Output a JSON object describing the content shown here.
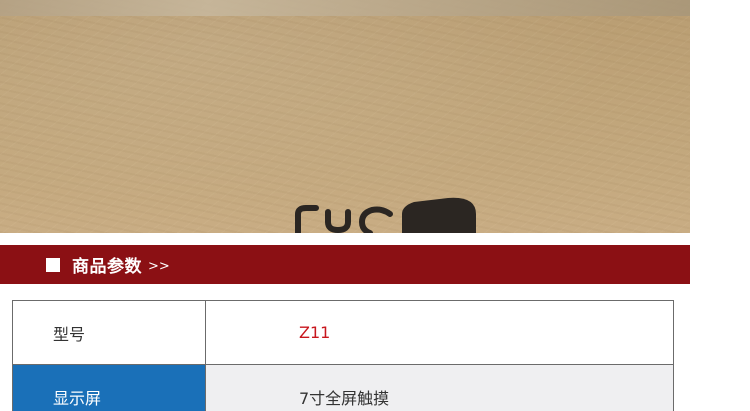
{
  "section": {
    "title": "商品参数",
    "arrow": ">>"
  },
  "params": [
    {
      "label": "型号",
      "value": "Z11",
      "value_color": "#c8161d"
    },
    {
      "label": "显示屏",
      "value": "7寸全屏触摸"
    }
  ],
  "colors": {
    "section_bar": "#8b1014",
    "highlight_label_bg": "#1a70b8",
    "alt_row_bg": "#efeff1",
    "accent_text": "#c8161d"
  }
}
